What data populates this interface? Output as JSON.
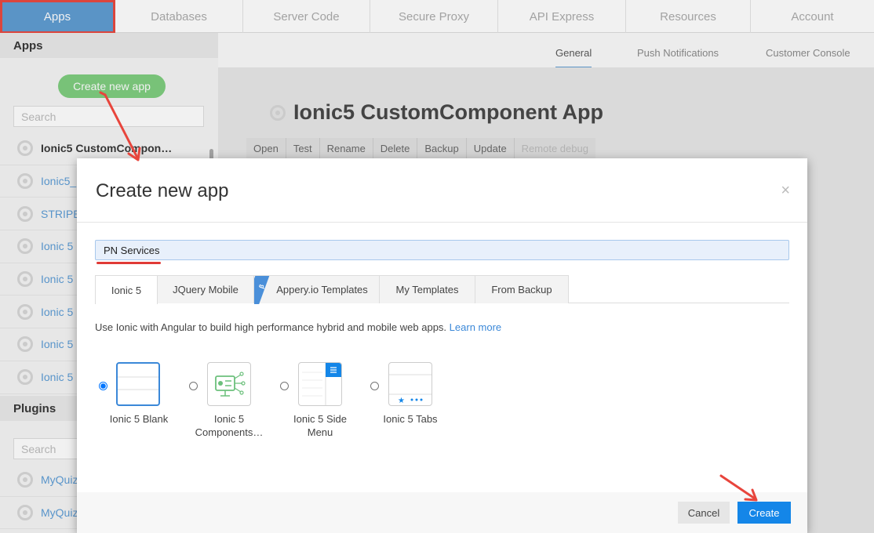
{
  "topnav": {
    "items": [
      "Apps",
      "Databases",
      "Server Code",
      "Secure Proxy",
      "API Express",
      "Resources",
      "Account"
    ]
  },
  "sidebar": {
    "apps_header": "Apps",
    "create_button": "Create new app",
    "search_placeholder": "Search",
    "apps": [
      "Ionic5 CustomCompon…",
      "Ionic5_",
      "STRIPE_",
      "Ionic 5",
      "Ionic 5",
      "Ionic 5",
      "Ionic 5",
      "Ionic 5"
    ],
    "plugins_header": "Plugins",
    "plugins_search_placeholder": "Search",
    "plugins": [
      "MyQuiz",
      "MyQuiz"
    ]
  },
  "main": {
    "subtabs": [
      "General",
      "Push Notifications",
      "Customer Console"
    ],
    "title": "Ionic5 CustomComponent App",
    "actions": [
      "Open",
      "Test",
      "Rename",
      "Delete",
      "Backup",
      "Update",
      "Remote debug"
    ]
  },
  "modal": {
    "title": "Create new app",
    "close": "×",
    "name_value": "PN Services",
    "tabs": [
      "Ionic 5",
      "JQuery Mobile",
      "Appery.io Templates",
      "My Templates",
      "From Backup"
    ],
    "beta_label": "β",
    "description": "Use Ionic with Angular to build high performance hybrid and mobile web apps.",
    "learn_more": "Learn more",
    "templates": [
      {
        "label": "Ionic 5 Blank",
        "selected": true
      },
      {
        "label": "Ionic 5 Components…",
        "selected": false
      },
      {
        "label": "Ionic 5 Side Menu",
        "selected": false
      },
      {
        "label": "Ionic 5 Tabs",
        "selected": false
      }
    ],
    "cancel": "Cancel",
    "create": "Create"
  },
  "colors": {
    "accent": "#5c9bd1",
    "create_green": "#7ccc7c",
    "primary_button": "#1486e8",
    "annotation_red": "#e8453c"
  }
}
